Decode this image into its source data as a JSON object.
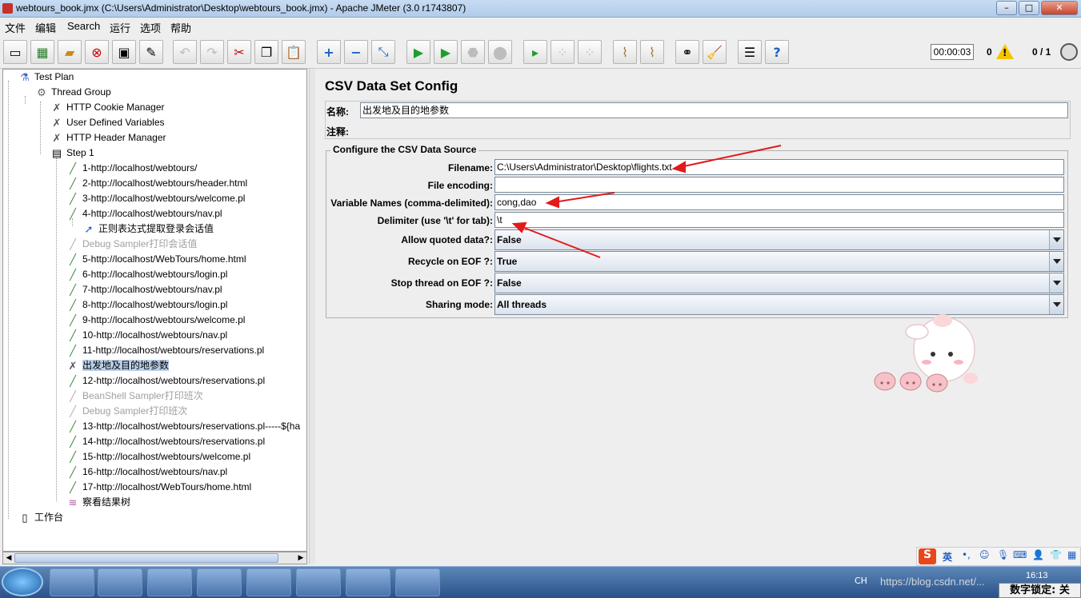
{
  "window": {
    "title": "webtours_book.jmx (C:\\Users\\Administrator\\Desktop\\webtours_book.jmx) - Apache JMeter (3.0 r1743807)",
    "minimize": "–",
    "maximize": "□",
    "close": "✕"
  },
  "menu": [
    "文件",
    "编辑",
    "Search",
    "运行",
    "选项",
    "帮助"
  ],
  "toolbar": {
    "timer": "00:00:03",
    "warnings": "0",
    "warning_mark": "!",
    "threads": "0 / 1"
  },
  "tree": {
    "nodes": [
      {
        "label": "Test Plan",
        "icon": "flask-icon",
        "glyph": "⚗"
      },
      {
        "label": "Thread Group",
        "icon": "gear-icon",
        "glyph": "⚙"
      },
      {
        "label": "HTTP Cookie Manager",
        "icon": "wrench-icon",
        "glyph": "✗"
      },
      {
        "label": "User Defined Variables",
        "icon": "wrench-icon",
        "glyph": "✗"
      },
      {
        "label": "HTTP Header Manager",
        "icon": "wrench-icon",
        "glyph": "✗"
      },
      {
        "label": "Step 1",
        "icon": "transaction-icon",
        "glyph": "▤"
      },
      {
        "label": "1-http://localhost/webtours/",
        "icon": "pipette-icon",
        "glyph": "╱"
      },
      {
        "label": "2-http://localhost/webtours/header.html",
        "icon": "pipette-icon",
        "glyph": "╱"
      },
      {
        "label": "3-http://localhost/webtours/welcome.pl",
        "icon": "pipette-icon",
        "glyph": "╱"
      },
      {
        "label": "4-http://localhost/webtours/nav.pl",
        "icon": "pipette-icon",
        "glyph": "╱"
      },
      {
        "label": "正则表达式提取登录会话值",
        "icon": "extractor-icon",
        "glyph": "➚"
      },
      {
        "label": "Debug Sampler打印会话值",
        "icon": "pipette-icon",
        "glyph": "╱"
      },
      {
        "label": "5-http://localhost/WebTours/home.html",
        "icon": "pipette-icon",
        "glyph": "╱"
      },
      {
        "label": "6-http://localhost/webtours/login.pl",
        "icon": "pipette-icon",
        "glyph": "╱"
      },
      {
        "label": "7-http://localhost/webtours/nav.pl",
        "icon": "pipette-icon",
        "glyph": "╱"
      },
      {
        "label": "8-http://localhost/webtours/login.pl",
        "icon": "pipette-icon",
        "glyph": "╱"
      },
      {
        "label": "9-http://localhost/webtours/welcome.pl",
        "icon": "pipette-icon",
        "glyph": "╱"
      },
      {
        "label": "10-http://localhost/webtours/nav.pl",
        "icon": "pipette-icon",
        "glyph": "╱"
      },
      {
        "label": "11-http://localhost/webtours/reservations.pl",
        "icon": "pipette-icon",
        "glyph": "╱"
      },
      {
        "label": "出发地及目的地参数",
        "icon": "wrench-icon",
        "glyph": "✗"
      },
      {
        "label": "12-http://localhost/webtours/reservations.pl",
        "icon": "pipette-icon",
        "glyph": "╱"
      },
      {
        "label": "BeanShell Sampler打印班次",
        "icon": "pipette-icon",
        "glyph": "╱"
      },
      {
        "label": "Debug Sampler打印班次",
        "icon": "pipette-icon",
        "glyph": "╱"
      },
      {
        "label": "13-http://localhost/webtours/reservations.pl-----${ha",
        "icon": "pipette-icon",
        "glyph": "╱"
      },
      {
        "label": "14-http://localhost/webtours/reservations.pl",
        "icon": "pipette-icon",
        "glyph": "╱"
      },
      {
        "label": "15-http://localhost/webtours/welcome.pl",
        "icon": "pipette-icon",
        "glyph": "╱"
      },
      {
        "label": "16-http://localhost/webtours/nav.pl",
        "icon": "pipette-icon",
        "glyph": "╱"
      },
      {
        "label": "17-http://localhost/WebTours/home.html",
        "icon": "pipette-icon",
        "glyph": "╱"
      },
      {
        "label": "察看结果树",
        "icon": "chart-icon",
        "glyph": "≋"
      },
      {
        "label": "工作台",
        "icon": "workbench-icon",
        "glyph": "▯"
      }
    ]
  },
  "panel": {
    "title": "CSV Data Set Config",
    "name_label": "名称:",
    "name_value": "出发地及目的地参数",
    "comment_label": "注释:",
    "comment_value": "",
    "section": "Configure the CSV Data Source",
    "fields": [
      {
        "label": "Filename:",
        "value": "C:\\Users\\Administrator\\Desktop\\flights.txt"
      },
      {
        "label": "File encoding:",
        "value": ""
      },
      {
        "label": "Variable Names (comma-delimited):",
        "value": "cong,dao"
      },
      {
        "label": "Delimiter (use '\\t' for tab):",
        "value": "\\t"
      }
    ],
    "combos": [
      {
        "label": "Allow quoted data?:",
        "value": "False"
      },
      {
        "label": "Recycle on EOF ?:",
        "value": "True"
      },
      {
        "label": "Stop thread on EOF ?:",
        "value": "False"
      },
      {
        "label": "Sharing mode:",
        "value": "All threads"
      }
    ]
  },
  "taskbar": {
    "lang": "CH",
    "clock": "16:13",
    "url": "https://blog.csdn.net/...",
    "numlock": "数字锁定: 关",
    "ime_label": "英"
  },
  "colors": {
    "accent_red": "#e21a1a",
    "selection": "#b9cfe8"
  }
}
